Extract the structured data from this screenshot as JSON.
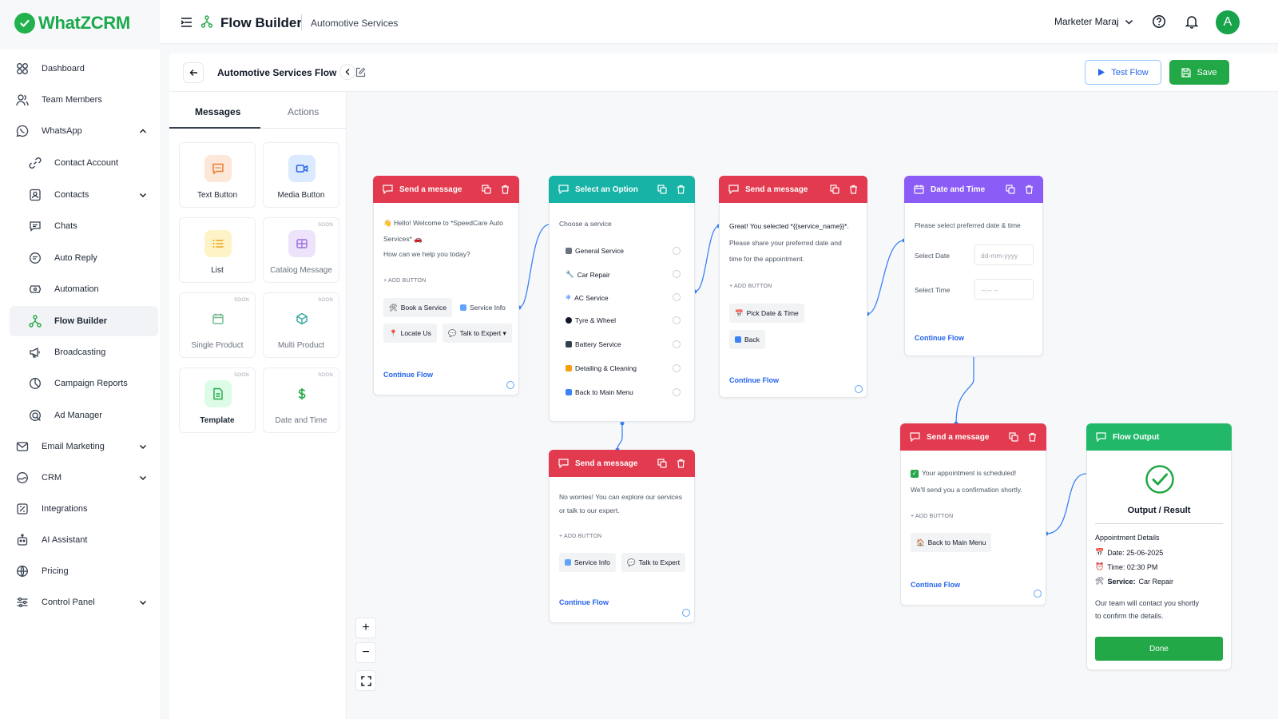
{
  "app": {
    "name": "WhatZCRM",
    "brand_color": "#22b14c"
  },
  "sidebar": {
    "items": [
      {
        "label": "Dashboard",
        "icon": "dashboard-icon"
      },
      {
        "label": "Team Members",
        "icon": "users-icon"
      },
      {
        "label": "WhatsApp",
        "icon": "whatsapp-icon",
        "expanded": true
      },
      {
        "label": "Contact Account",
        "icon": "link-icon"
      },
      {
        "label": "Contacts",
        "icon": "contacts-icon"
      },
      {
        "label": "Chats",
        "icon": "chat-icon"
      },
      {
        "label": "Auto Reply",
        "icon": "auto-reply-icon"
      },
      {
        "label": "Automation",
        "icon": "automation-icon"
      },
      {
        "label": "Flow Builder",
        "icon": "flow-icon",
        "active": true
      },
      {
        "label": "Broadcasting",
        "icon": "megaphone-icon"
      },
      {
        "label": "Campaign Reports",
        "icon": "report-icon"
      },
      {
        "label": "Ad Manager",
        "icon": "ad-icon"
      },
      {
        "label": "Email Marketing",
        "icon": "mail-icon"
      },
      {
        "label": "CRM",
        "icon": "crm-icon"
      },
      {
        "label": "Integrations",
        "icon": "integrations-icon"
      },
      {
        "label": "AI Assistant",
        "icon": "robot-icon"
      },
      {
        "label": "Pricing",
        "icon": "globe-icon"
      },
      {
        "label": "Control Panel",
        "icon": "sliders-icon"
      }
    ]
  },
  "header": {
    "title": "Flow Builder",
    "subtitle": "Automotive Services",
    "user": "Marketer Maraj",
    "avatar_letter": "A"
  },
  "toolbar": {
    "flow_name": "Automotive Services Flow",
    "test_label": "Test Flow",
    "save_label": "Save"
  },
  "palette": {
    "tabs": [
      {
        "label": "Messages"
      },
      {
        "label": "Actions"
      }
    ],
    "soon_label": "SOON",
    "tiles": [
      {
        "label": "Text Button"
      },
      {
        "label": "Media Button"
      },
      {
        "label": "List"
      },
      {
        "label": "Catalog Message"
      },
      {
        "label": "Single Product"
      },
      {
        "label": "Multi Product"
      },
      {
        "label": "Template"
      },
      {
        "label": "Date and Time"
      }
    ]
  },
  "nodes": {
    "welcome": {
      "title": "Send a message",
      "line1": "👋 Hello! Welcome to *SpeedCare Auto",
      "line2": "Services* 🚗",
      "line3": "How can we help you today?",
      "add": "+ ADD BUTTON",
      "buttons": [
        "Book a Service",
        "Service Info",
        "Locate Us",
        "Talk to Expert ▾"
      ],
      "cont": "Continue Flow"
    },
    "select": {
      "title": "Select an Option",
      "prompt": "Choose a service",
      "options": [
        "General Service",
        "Car Repair",
        "AC Service",
        "Tyre & Wheel",
        "Battery Service",
        "Detailing & Cleaning",
        "Back to Main Menu"
      ]
    },
    "selected": {
      "title": "Send a message",
      "line1": "Great! You selected *{{service_name}}*.",
      "line2": "Please share your preferred date and",
      "line3": "time for the appointment.",
      "add": "+ ADD BUTTON",
      "buttons": [
        "Pick Date & Time",
        "Back"
      ],
      "cont": "Continue Flow"
    },
    "datetime": {
      "title": "Date and Time",
      "prompt": "Please select preferred date & time",
      "date_label": "Select Date",
      "date_placeholder": "dd-mm-yyyy",
      "time_label": "Select Time",
      "time_placeholder": "--:-- --",
      "cont": "Continue Flow"
    },
    "worries": {
      "title": "Send a message",
      "line1": "No worries! You can explore our services",
      "line2": "or talk to our expert.",
      "add": "+ ADD BUTTON",
      "buttons": [
        "Service Info",
        "Talk to Expert"
      ],
      "cont": "Continue Flow"
    },
    "scheduled": {
      "title": "Send a message",
      "line1": "Your appointment is scheduled!",
      "line2": "We'll send you a confirmation shortly.",
      "add": "+ ADD BUTTON",
      "buttons": [
        "Back to Main Menu"
      ],
      "cont": "Continue Flow"
    },
    "output": {
      "title": "Flow Output",
      "result": "Output / Result",
      "details": "Appointment Details",
      "date": "Date: 25-06-2025",
      "time": "Time: 02:30 PM",
      "service_label": "Service:",
      "service_value": "Car Repair",
      "note1": "Our team will contact you shortly",
      "note2": "to confirm the details.",
      "done": "Done"
    }
  },
  "zoom": {
    "in": "+",
    "out": "−"
  }
}
